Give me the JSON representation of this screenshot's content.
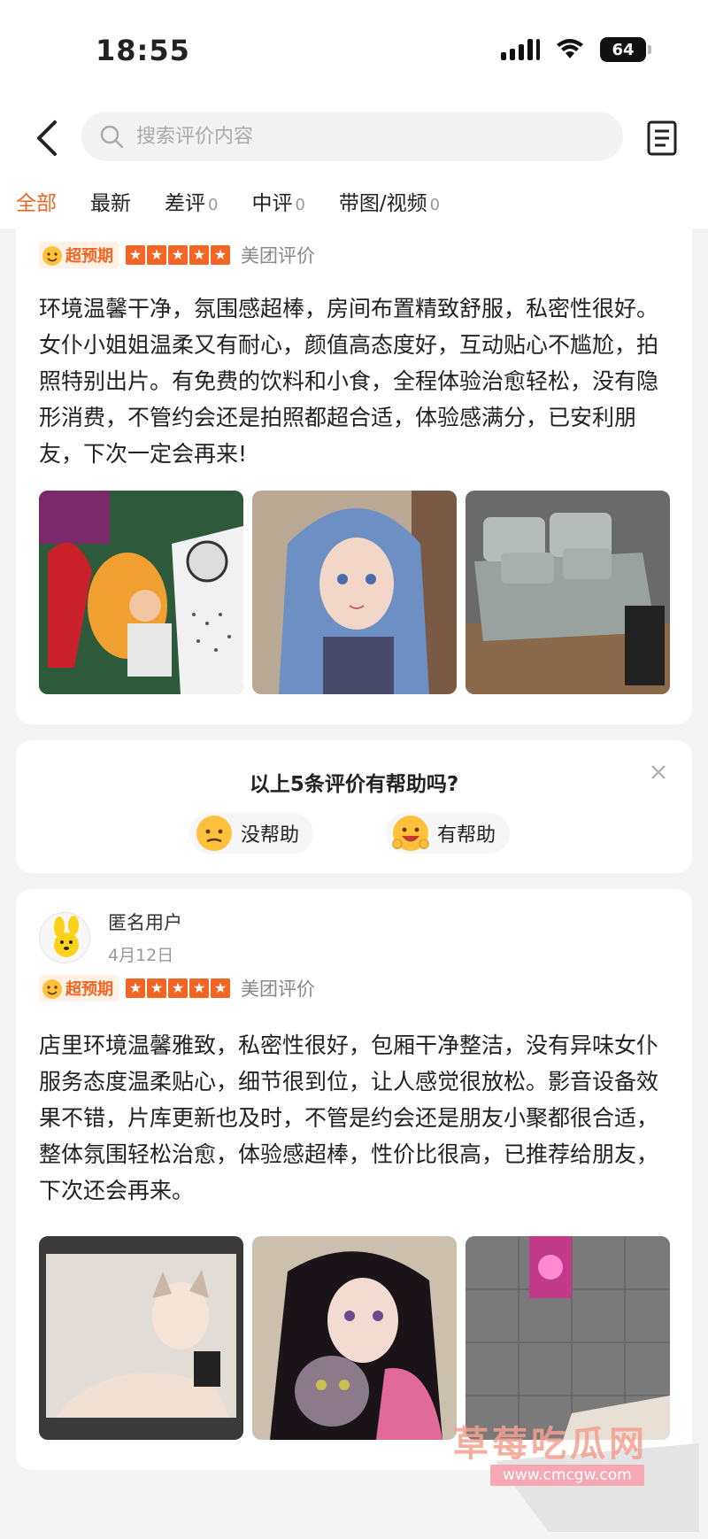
{
  "status": {
    "time": "18:55",
    "battery": "64"
  },
  "header": {
    "search_placeholder": "搜索评价内容",
    "tabs": [
      {
        "label": "全部",
        "count": ""
      },
      {
        "label": "最新",
        "count": ""
      },
      {
        "label": "差评",
        "count": "0"
      },
      {
        "label": "中评",
        "count": "0"
      },
      {
        "label": "带图/视频",
        "count": "0"
      }
    ]
  },
  "reviews": [
    {
      "badge": "超预期",
      "stars": 5,
      "source": "美团评价",
      "text": "环境温馨干净，氛围感超棒，房间布置精致舒服，私密性很好。女仆小姐姐温柔又有耐心，颜值高态度好，互动贴心不尴尬，拍照特别出片。有免费的饮料和小食，全程体验治愈轻松，没有隐形消费，不管约会还是拍照都超合适，体验感满分，已安利朋友，下次一定会再来!"
    },
    {
      "user": "匿名用户",
      "date": "4月12日",
      "badge": "超预期",
      "stars": 5,
      "source": "美团评价",
      "text": "店里环境温馨雅致，私密性很好，包厢干净整洁，没有异味女仆服务态度温柔贴心，细节很到位，让人感觉很放松。影音设备效果不错，片库更新也及时，不管是约会还是朋友小聚都很合适，整体氛围轻松治愈，体验感超棒，性价比很高，已推荐给朋友，下次还会再来。"
    }
  ],
  "helpful": {
    "question": "以上5条评价有帮助吗?",
    "no_label": "没帮助",
    "yes_label": "有帮助"
  },
  "watermark": {
    "title": "草莓吃瓜网",
    "url": "www.cmcgw.com"
  },
  "colors": {
    "accent": "#f26522",
    "background": "#f4f4f4"
  }
}
